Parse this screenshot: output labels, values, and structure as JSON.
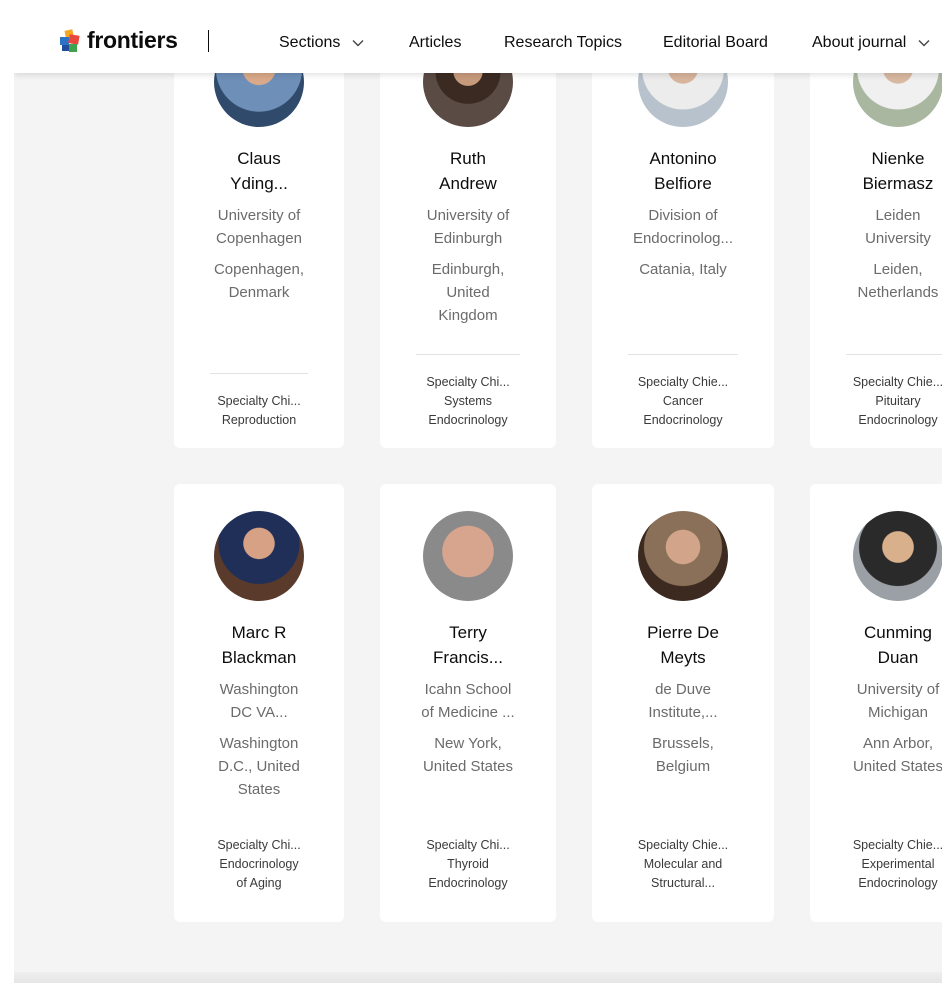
{
  "header": {
    "logo_text": "frontiers",
    "nav": [
      {
        "label": "Sections",
        "has_dropdown": true
      },
      {
        "label": "Articles",
        "has_dropdown": false
      },
      {
        "label": "Research Topics",
        "has_dropdown": false
      },
      {
        "label": "Editorial Board",
        "has_dropdown": false
      },
      {
        "label": "About journal",
        "has_dropdown": true
      }
    ]
  },
  "editors": [
    {
      "name_line1": "Claus",
      "name_line2": "Yding...",
      "institution_line1": "University of",
      "institution_line2": "Copenhagen",
      "location_line1": "Copenhagen,",
      "location_line2": "Denmark",
      "location_line3": "",
      "role_line1": "Specialty Chi...",
      "role_line2": "Reproduction",
      "role_line3": ""
    },
    {
      "name_line1": "Ruth",
      "name_line2": "Andrew",
      "institution_line1": "University of",
      "institution_line2": "Edinburgh",
      "location_line1": "Edinburgh,",
      "location_line2": "United",
      "location_line3": "Kingdom",
      "role_line1": "Specialty Chi...",
      "role_line2": "Systems",
      "role_line3": "Endocrinology"
    },
    {
      "name_line1": "Antonino",
      "name_line2": "Belfiore",
      "institution_line1": "Division of",
      "institution_line2": "Endocrinolog...",
      "location_line1": "Catania, Italy",
      "location_line2": "",
      "location_line3": "",
      "role_line1": "Specialty Chie...",
      "role_line2": "Cancer",
      "role_line3": "Endocrinology"
    },
    {
      "name_line1": "Nienke",
      "name_line2": "Biermasz",
      "institution_line1": "Leiden",
      "institution_line2": "University",
      "location_line1": "Leiden,",
      "location_line2": "Netherlands",
      "location_line3": "",
      "role_line1": "Specialty Chie...",
      "role_line2": "Pituitary",
      "role_line3": "Endocrinology"
    },
    {
      "name_line1": "Marc R",
      "name_line2": "Blackman",
      "institution_line1": "Washington",
      "institution_line2": "DC VA...",
      "location_line1": "Washington",
      "location_line2": "D.C., United",
      "location_line3": "States",
      "role_line1": "Specialty Chi...",
      "role_line2": "Endocrinology",
      "role_line3": "of Aging"
    },
    {
      "name_line1": "Terry",
      "name_line2": "Francis...",
      "institution_line1": "Icahn School",
      "institution_line2": "of Medicine ...",
      "location_line1": "New York,",
      "location_line2": "United States",
      "location_line3": "",
      "role_line1": "Specialty Chi...",
      "role_line2": "Thyroid",
      "role_line3": "Endocrinology"
    },
    {
      "name_line1": "Pierre De",
      "name_line2": "Meyts",
      "institution_line1": "de Duve",
      "institution_line2": "Institute,...",
      "location_line1": "Brussels,",
      "location_line2": "Belgium",
      "location_line3": "",
      "role_line1": "Specialty Chie...",
      "role_line2": "Molecular and",
      "role_line3": "Structural..."
    },
    {
      "name_line1": "Cunming",
      "name_line2": "Duan",
      "institution_line1": "University of",
      "institution_line2": "Michigan",
      "location_line1": "Ann Arbor,",
      "location_line2": "United States",
      "location_line3": "",
      "role_line1": "Specialty Chie...",
      "role_line2": "Experimental",
      "role_line3": "Endocrinology"
    }
  ]
}
